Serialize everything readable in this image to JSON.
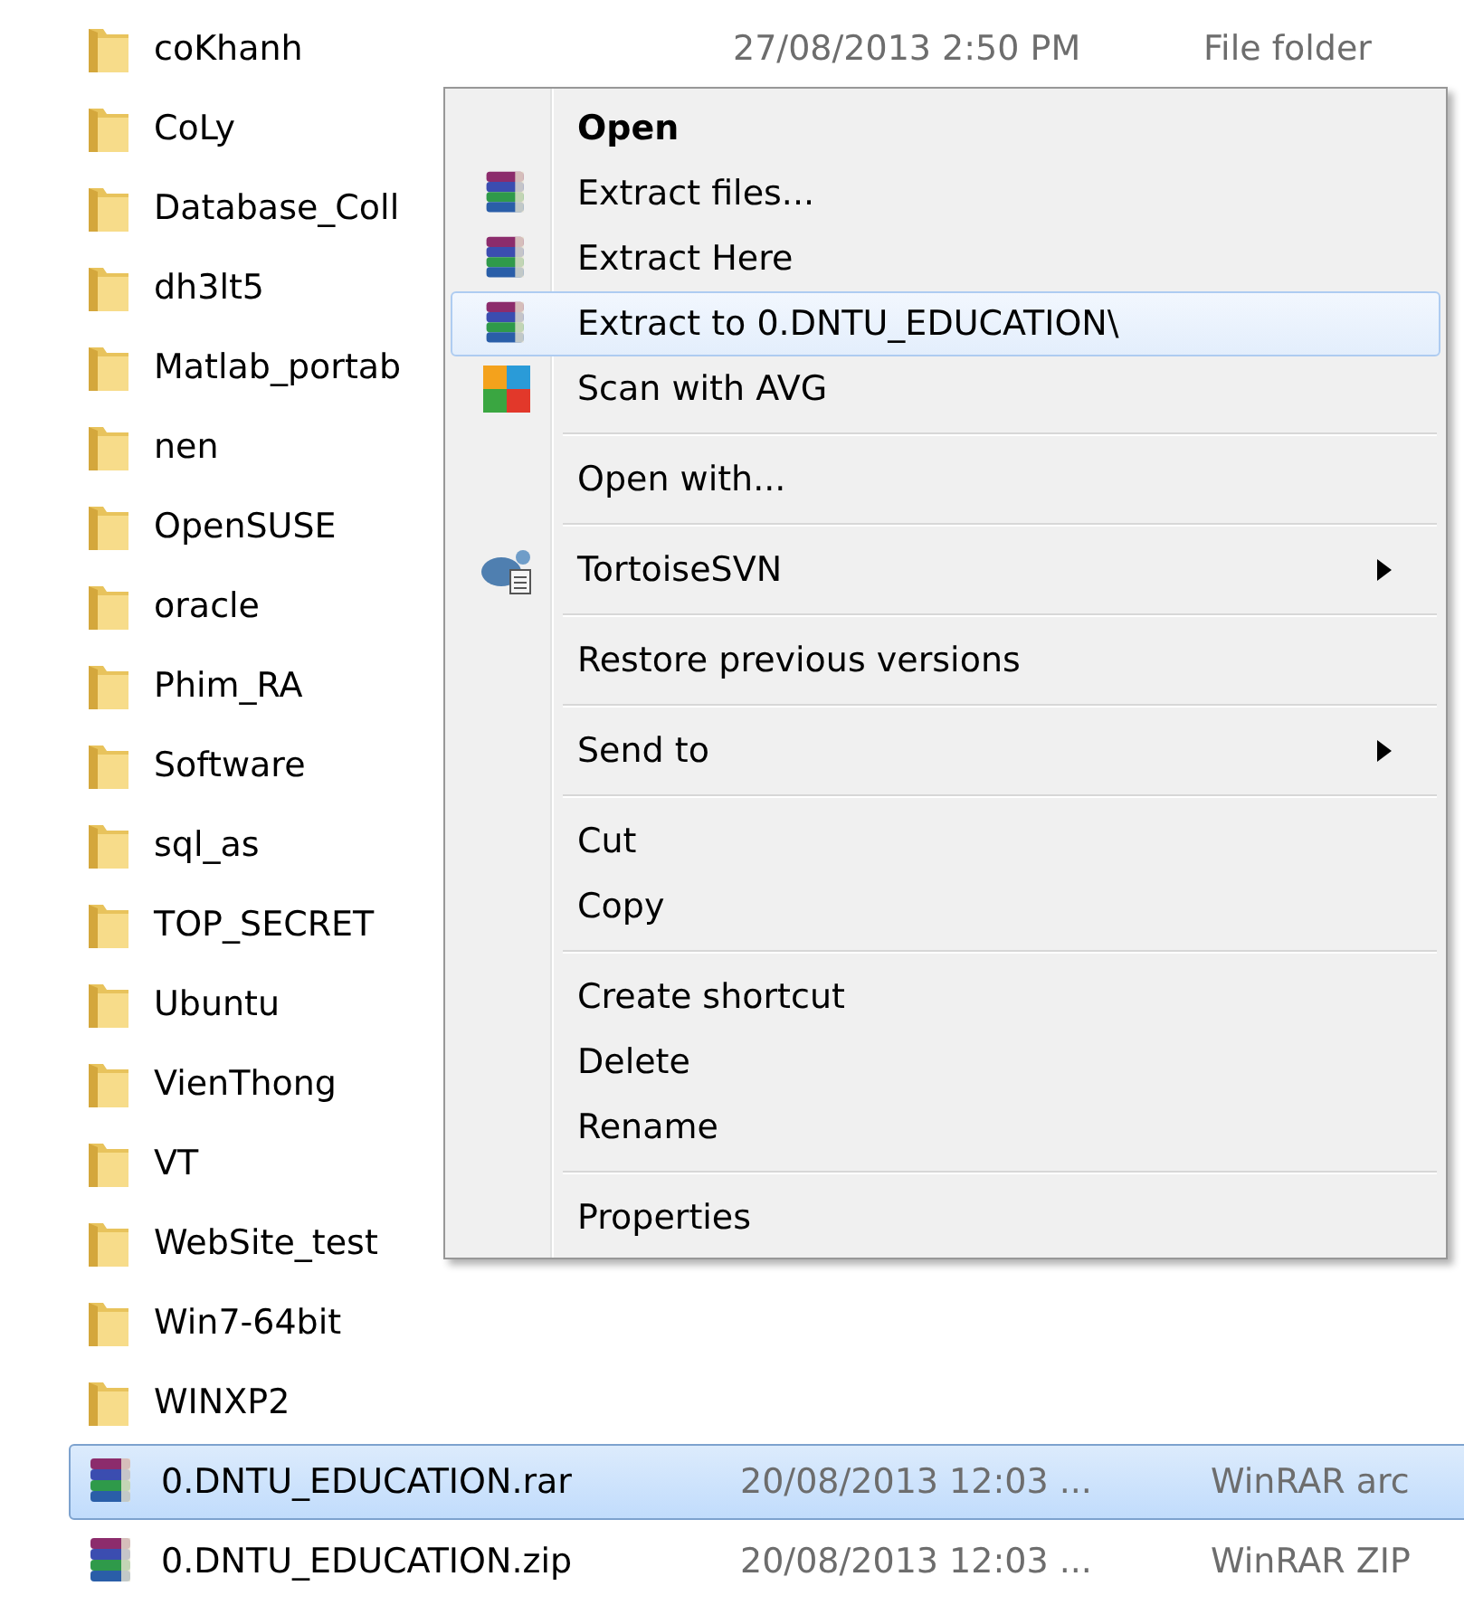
{
  "files": [
    {
      "name": "coKhanh",
      "kind": "folder",
      "selected": false,
      "date": "27/08/2013 2:50 PM",
      "type": "File folder"
    },
    {
      "name": "CoLy",
      "kind": "folder",
      "selected": false
    },
    {
      "name": "Database_Coll",
      "kind": "folder",
      "selected": false
    },
    {
      "name": "dh3lt5",
      "kind": "folder",
      "selected": false
    },
    {
      "name": "Matlab_portab",
      "kind": "folder",
      "selected": false
    },
    {
      "name": "nen",
      "kind": "folder",
      "selected": false
    },
    {
      "name": "OpenSUSE",
      "kind": "folder",
      "selected": false
    },
    {
      "name": "oracle",
      "kind": "folder",
      "selected": false
    },
    {
      "name": "Phim_RA",
      "kind": "folder",
      "selected": false
    },
    {
      "name": "Software",
      "kind": "folder",
      "selected": false
    },
    {
      "name": "sql_as",
      "kind": "folder",
      "selected": false
    },
    {
      "name": "TOP_SECRET",
      "kind": "folder",
      "selected": false
    },
    {
      "name": "Ubuntu",
      "kind": "folder",
      "selected": false
    },
    {
      "name": "VienThong",
      "kind": "folder",
      "selected": false
    },
    {
      "name": "VT",
      "kind": "folder",
      "selected": false
    },
    {
      "name": "WebSite_test",
      "kind": "folder",
      "selected": false
    },
    {
      "name": "Win7-64bit",
      "kind": "folder",
      "selected": false
    },
    {
      "name": "WINXP2",
      "kind": "folder",
      "selected": false
    },
    {
      "name": "0.DNTU_EDUCATION.rar",
      "kind": "archive",
      "selected": true,
      "date": "20/08/2013 12:03 ...",
      "type": "WinRAR arc"
    },
    {
      "name": "0.DNTU_EDUCATION.zip",
      "kind": "archive",
      "selected": false,
      "date": "20/08/2013 12:03 ...",
      "type": "WinRAR ZIP"
    }
  ],
  "context_menu": [
    {
      "kind": "default",
      "label": "Open",
      "selected": false
    },
    {
      "kind": "archive",
      "label": "Extract files...",
      "selected": false
    },
    {
      "kind": "archive",
      "label": "Extract Here",
      "selected": false
    },
    {
      "kind": "archive",
      "label": "Extract to 0.DNTU_EDUCATION\\",
      "selected": true
    },
    {
      "kind": "antivirus",
      "label": "Scan with AVG",
      "selected": false
    },
    {
      "kind": "separator"
    },
    {
      "kind": "plain",
      "label": "Open with...",
      "selected": false
    },
    {
      "kind": "separator"
    },
    {
      "kind": "version-control",
      "label": "TortoiseSVN",
      "selected": false,
      "submenu": true
    },
    {
      "kind": "separator"
    },
    {
      "kind": "plain",
      "label": "Restore previous versions",
      "selected": false
    },
    {
      "kind": "separator"
    },
    {
      "kind": "plain",
      "label": "Send to",
      "selected": false,
      "submenu": true
    },
    {
      "kind": "separator"
    },
    {
      "kind": "plain",
      "label": "Cut",
      "selected": false
    },
    {
      "kind": "plain",
      "label": "Copy",
      "selected": false
    },
    {
      "kind": "separator"
    },
    {
      "kind": "plain",
      "label": "Create shortcut",
      "selected": false
    },
    {
      "kind": "plain",
      "label": "Delete",
      "selected": false
    },
    {
      "kind": "plain",
      "label": "Rename",
      "selected": false
    },
    {
      "kind": "separator"
    },
    {
      "kind": "plain",
      "label": "Properties",
      "selected": false
    }
  ]
}
